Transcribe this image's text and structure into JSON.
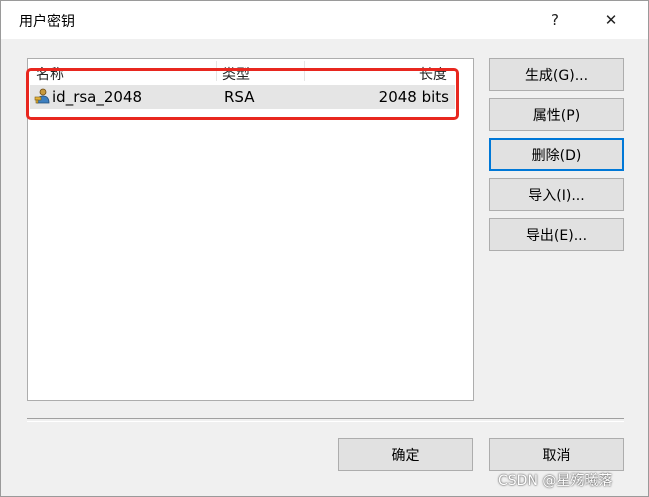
{
  "window": {
    "title": "用户密钥",
    "help_glyph": "?",
    "close_glyph": "✕"
  },
  "list": {
    "columns": [
      "名称",
      "类型",
      "长度"
    ],
    "rows": [
      {
        "name": "id_rsa_2048",
        "type": "RSA",
        "length": "2048 bits",
        "icon": "key-user-icon"
      }
    ]
  },
  "side_buttons": {
    "generate": "生成(G)...",
    "properties": "属性(P)",
    "delete": "删除(D)",
    "import": "导入(I)...",
    "export": "导出(E)..."
  },
  "footer": {
    "ok": "确定",
    "cancel": "取消"
  },
  "watermark": "CSDN @星殇曦落",
  "colors": {
    "highlight_box": "#e8271f",
    "focus": "#0078d7",
    "selected_row": "#e5e5e5"
  }
}
